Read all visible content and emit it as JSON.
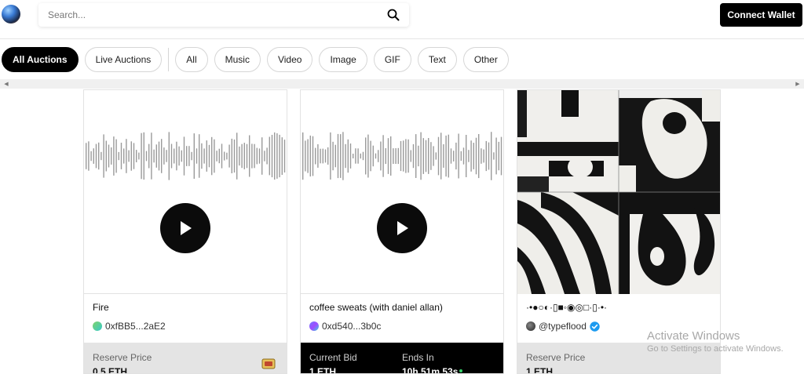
{
  "header": {
    "search": {
      "placeholder": "Search..."
    },
    "connect_label": "Connect Wallet"
  },
  "filters": [
    {
      "label": "All Auctions",
      "active": true
    },
    {
      "label": "Live Auctions",
      "active": false
    },
    {
      "label": "All",
      "active": false
    },
    {
      "label": "Music",
      "active": false
    },
    {
      "label": "Video",
      "active": false
    },
    {
      "label": "Image",
      "active": false
    },
    {
      "label": "GIF",
      "active": false
    },
    {
      "label": "Text",
      "active": false
    },
    {
      "label": "Other",
      "active": false
    }
  ],
  "cards": [
    {
      "title": "Fire",
      "owner": "0xfBB5...2aE2",
      "owner_color": "#7fd36b",
      "price_label": "Reserve Price",
      "price": "0.5 ETH"
    },
    {
      "title": "coffee sweats (with daniel allan)",
      "owner": "0xd540...3b0c",
      "owner_color": "#6d7bff",
      "bid_label": "Current Bid",
      "bid": "1 ETH",
      "ends_label": "Ends In",
      "ends": "10h 51m 53s"
    },
    {
      "title": "·•●○◐·▯■◦◉◎□·▯·•·",
      "owner": "@typeflood",
      "price_label": "Reserve Price",
      "price": "1 ETH"
    }
  ],
  "watermark": {
    "title": "Activate Windows",
    "subtitle": "Go to Settings to activate Windows."
  },
  "colors": {
    "accent": "#000000",
    "verified": "#1d9bf0"
  }
}
